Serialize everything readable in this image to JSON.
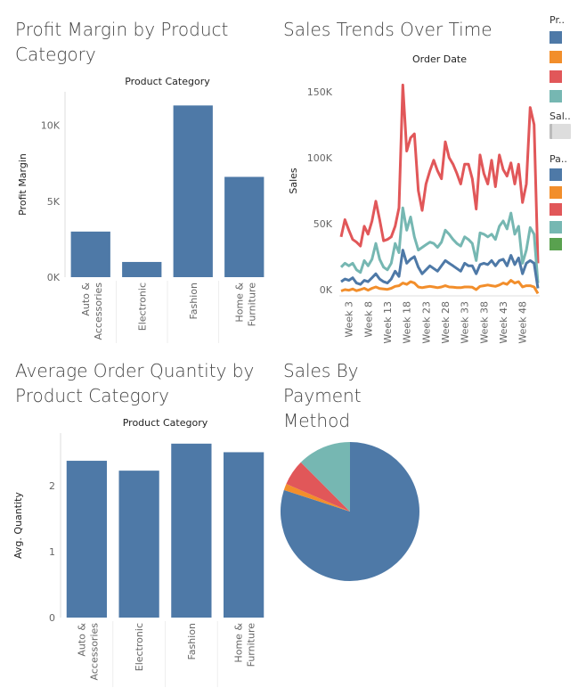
{
  "dashboard": {
    "profit_title": "Profit Margin by Product Category",
    "sales_title": "Sales Trends Over Time",
    "qty_title": "Average Order Quantity by Product Category",
    "payment_title": "Sales By Payment Method"
  },
  "legend": {
    "product_header": "Pr..",
    "sales_header": "Sal..",
    "payment_header": "Pa..",
    "product_colors": [
      "#4e79a7",
      "#f28e2b",
      "#e15759",
      "#76b7b2"
    ],
    "payment_colors": [
      "#4e79a7",
      "#f28e2b",
      "#e15759",
      "#76b7b2",
      "#59a14f"
    ]
  },
  "chart_data": [
    {
      "id": "profit",
      "type": "bar",
      "title": "Profit Margin by Product Category",
      "column_header": "Product Category",
      "ylabel": "Profit Margin",
      "categories": [
        "Auto & Accessories",
        "Electronic",
        "Fashion",
        "Home & Furniture"
      ],
      "values": [
        3000,
        1000,
        11300,
        6600
      ],
      "ylim": [
        0,
        12200
      ],
      "yticks": [
        0,
        5000,
        10000
      ],
      "ytick_labels": [
        "0K",
        "5K",
        "10K"
      ],
      "color": "#4e79a7"
    },
    {
      "id": "sales",
      "type": "line",
      "title": "Sales Trends Over Time",
      "column_header": "Order Date",
      "ylabel": "Sales",
      "x": [
        "Week 1",
        "Week 2",
        "Week 3",
        "Week 4",
        "Week 5",
        "Week 6",
        "Week 7",
        "Week 8",
        "Week 9",
        "Week 10",
        "Week 11",
        "Week 12",
        "Week 13",
        "Week 14",
        "Week 15",
        "Week 16",
        "Week 17",
        "Week 18",
        "Week 19",
        "Week 20",
        "Week 21",
        "Week 22",
        "Week 23",
        "Week 24",
        "Week 25",
        "Week 26",
        "Week 27",
        "Week 28",
        "Week 29",
        "Week 30",
        "Week 31",
        "Week 32",
        "Week 33",
        "Week 34",
        "Week 35",
        "Week 36",
        "Week 37",
        "Week 38",
        "Week 39",
        "Week 40",
        "Week 41",
        "Week 42",
        "Week 43",
        "Week 44",
        "Week 45",
        "Week 46",
        "Week 47",
        "Week 48",
        "Week 49",
        "Week 50",
        "Week 51",
        "Week 52"
      ],
      "xtick_labels": [
        "Week 3",
        "Week 8",
        "Week 13",
        "Week 18",
        "Week 23",
        "Week 28",
        "Week 33",
        "Week 38",
        "Week 43",
        "Week 48"
      ],
      "ylim": [
        0,
        160000
      ],
      "yticks": [
        0,
        50000,
        100000,
        150000
      ],
      "ytick_labels": [
        "0K",
        "50K",
        "100K",
        "150K"
      ],
      "series": [
        {
          "color": "#e15759",
          "values": [
            40000,
            53000,
            45000,
            38000,
            36000,
            33000,
            48000,
            42000,
            52000,
            67000,
            53000,
            37000,
            38000,
            40000,
            48000,
            62000,
            155000,
            105000,
            115000,
            118000,
            75000,
            60000,
            80000,
            90000,
            98000,
            90000,
            84000,
            112000,
            100000,
            95000,
            88000,
            80000,
            95000,
            95000,
            84000,
            61000,
            102000,
            88000,
            80000,
            98000,
            78000,
            102000,
            91000,
            86000,
            96000,
            80000,
            95000,
            66000,
            80000,
            138000,
            125000,
            20000
          ]
        },
        {
          "color": "#76b7b2",
          "values": [
            17000,
            20000,
            18000,
            20000,
            15000,
            13000,
            22000,
            18000,
            23000,
            35000,
            23000,
            17000,
            15000,
            20000,
            35000,
            28000,
            62000,
            45000,
            55000,
            40000,
            30000,
            32000,
            34000,
            36000,
            35000,
            32000,
            36000,
            45000,
            42000,
            38000,
            35000,
            33000,
            40000,
            38000,
            35000,
            22000,
            43000,
            42000,
            40000,
            42000,
            38000,
            48000,
            52000,
            46000,
            58000,
            42000,
            48000,
            20000,
            30000,
            47000,
            42000,
            5000
          ]
        },
        {
          "color": "#4e79a7",
          "values": [
            6000,
            8000,
            7000,
            9000,
            5000,
            4000,
            7000,
            6000,
            9000,
            12000,
            8000,
            6000,
            5000,
            8000,
            14000,
            10000,
            30000,
            20000,
            23000,
            25000,
            17000,
            12000,
            15000,
            18000,
            16000,
            14000,
            18000,
            22000,
            20000,
            18000,
            16000,
            14000,
            20000,
            18000,
            18000,
            12000,
            19000,
            20000,
            19000,
            22000,
            18000,
            22000,
            23000,
            18000,
            26000,
            19000,
            24000,
            12000,
            20000,
            22000,
            20000,
            1000
          ]
        },
        {
          "color": "#f28e2b",
          "values": [
            -1000,
            0,
            -500,
            500,
            -800,
            0,
            1000,
            -500,
            1000,
            2000,
            800,
            500,
            200,
            1000,
            2500,
            3000,
            5000,
            4000,
            6000,
            5000,
            2000,
            1500,
            2000,
            2500,
            2000,
            1500,
            2000,
            3000,
            2000,
            1800,
            1500,
            1500,
            2000,
            2000,
            1800,
            0,
            2500,
            3000,
            3500,
            3000,
            2500,
            3500,
            5000,
            4000,
            7000,
            5000,
            6000,
            2000,
            3000,
            3000,
            2000,
            -3000
          ]
        }
      ]
    },
    {
      "id": "qty",
      "type": "bar",
      "title": "Average Order Quantity by Product Category",
      "column_header": "Product Category",
      "ylabel": "Avg. Quantity",
      "categories": [
        "Auto & Accessories",
        "Electronic",
        "Fashion",
        "Home & Furniture"
      ],
      "values": [
        2.38,
        2.23,
        2.64,
        2.51
      ],
      "ylim": [
        0,
        2.8
      ],
      "yticks": [
        0,
        1,
        2
      ],
      "ytick_labels": [
        "0",
        "1",
        "2"
      ],
      "color": "#4e79a7"
    },
    {
      "id": "payment",
      "type": "pie",
      "title": "Sales By Payment Method",
      "values": [
        80.0,
        1.5,
        6.0,
        12.5
      ],
      "colors": [
        "#4e79a7",
        "#f28e2b",
        "#e15759",
        "#76b7b2"
      ]
    }
  ]
}
